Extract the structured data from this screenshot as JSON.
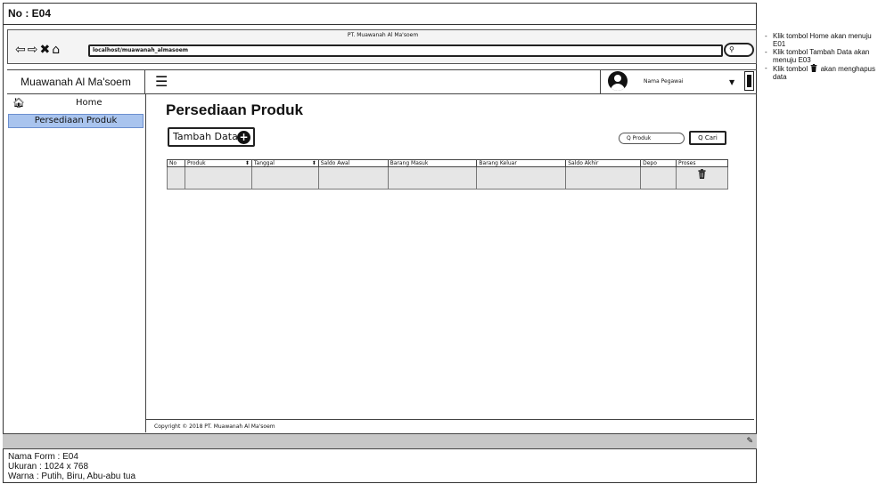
{
  "form_code": "No : E04",
  "browser": {
    "window_title": "PT. Muawanah Al Ma'soem",
    "url": "localhost/muawanah_almasoem",
    "nav_icons": [
      "back-icon",
      "forward-icon",
      "close-icon",
      "home-icon"
    ]
  },
  "header": {
    "brand": "Muawanah Al Ma'soem",
    "user_name": "Nama Pegawai"
  },
  "sidebar": {
    "items": [
      {
        "label": "Home",
        "icon": "home-icon",
        "active": false
      },
      {
        "label": "Persediaan Produk",
        "active": true
      }
    ]
  },
  "main": {
    "page_title": "Persediaan Produk",
    "add_button": "Tambah Data",
    "search_placeholder": "Produk",
    "search_button": "Cari",
    "table": {
      "columns": [
        "No",
        "Produk",
        "Tanggal",
        "Saldo Awal",
        "Barang Masuk",
        "Barang Keluar",
        "Saldo Akhir",
        "Depo",
        "Proses"
      ],
      "sortable": [
        "Produk",
        "Tanggal"
      ],
      "rows": [
        []
      ]
    }
  },
  "footer": {
    "copyright": "Copyright © 2018 PT. Muawanah Al Ma'soem"
  },
  "notes": {
    "form_name": "Nama Form : E04",
    "size": "Ukuran : 1024 x 768",
    "colors": "Warna : Putih, Biru, Abu-abu tua",
    "right": [
      "Klik tombol Home akan menuju E01",
      "Klik tombol Tambah Data akan menuju E03",
      "Klik tombol",
      "akan menghapus data"
    ]
  },
  "colors": {
    "active_item": "#a9c4ee",
    "footer_bar": "#c7c7c7",
    "table_row": "#e6e6e6"
  }
}
